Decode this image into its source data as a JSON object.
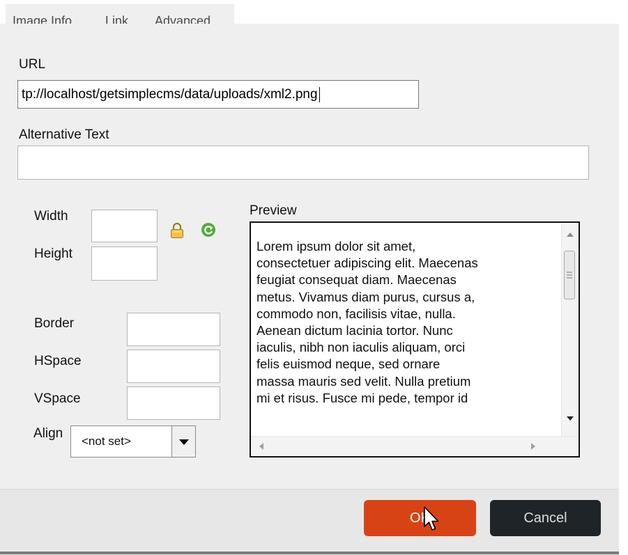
{
  "tabs": [
    {
      "label": "Image Info",
      "active": true
    },
    {
      "label": "Link",
      "active": false
    },
    {
      "label": "Advanced",
      "active": false
    }
  ],
  "url": {
    "label": "URL",
    "value": "tp://localhost/getsimplecms/data/uploads/xml2.png"
  },
  "alt_text": {
    "label": "Alternative Text",
    "value": ""
  },
  "dimensions": {
    "width_label": "Width",
    "width_value": "",
    "height_label": "Height",
    "height_value": ""
  },
  "spacing": {
    "border_label": "Border",
    "border_value": "",
    "hspace_label": "HSpace",
    "hspace_value": "",
    "vspace_label": "VSpace",
    "vspace_value": ""
  },
  "align": {
    "label": "Align",
    "selected": "<not set>"
  },
  "preview": {
    "label": "Preview",
    "lines": [
      "Lorem ipsum dolor sit amet,",
      "consectetuer adipiscing elit. Maecenas",
      "feugiat consequat diam. Maecenas",
      "metus. Vivamus diam purus, cursus a,",
      "commodo non, facilisis vitae, nulla.",
      "Aenean dictum lacinia tortor. Nunc",
      "iaculis, nibh non iaculis aliquam, orci",
      "felis euismod neque, sed ornare",
      "massa mauris sed velit. Nulla pretium",
      "mi et risus. Fusce mi pede, tempor id"
    ]
  },
  "footer": {
    "ok_label": "OK",
    "cancel_label": "Cancel"
  },
  "colors": {
    "ok": "#d84315",
    "cancel": "#1f2428",
    "panel": "#efefef"
  },
  "icons": [
    "lock-icon",
    "reset-size-icon",
    "mouse-cursor-icon"
  ]
}
